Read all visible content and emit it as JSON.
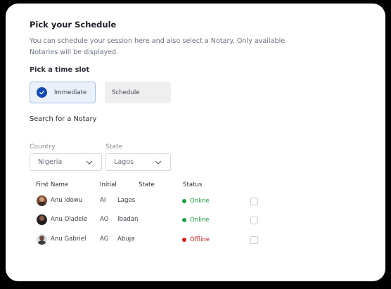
{
  "title": "Pick your Schedule",
  "description": "You can schedule your session here and also select a Notary. Only available Notaries will be displayed.",
  "time_slot": {
    "label": "Pick a time slot",
    "immediate": "Immediate",
    "schedule": "Schedule",
    "selected": "Immediate"
  },
  "search": {
    "label": "Search for a Notary",
    "country": {
      "label": "Country",
      "value": "Nigeria"
    },
    "state": {
      "label": "State",
      "value": "Lagos"
    }
  },
  "table": {
    "headers": [
      "First Name",
      "Initial",
      "State",
      "Status"
    ],
    "rows": [
      {
        "name": "Anu Idowu",
        "initial": "AI",
        "state": "Lagos",
        "status": "Online",
        "status_color": "#1aa33a"
      },
      {
        "name": "Anu Oladele",
        "initial": "AO",
        "state": "Ibadan",
        "status": "Online",
        "status_color": "#1aa33a"
      },
      {
        "name": "Anu Gabriel",
        "initial": "AG",
        "state": "Abuja",
        "status": "Offline",
        "status_color": "#d42020"
      }
    ]
  },
  "colors": {
    "accent": "#1348b5",
    "online": "#1aa33a",
    "offline": "#d42020"
  }
}
